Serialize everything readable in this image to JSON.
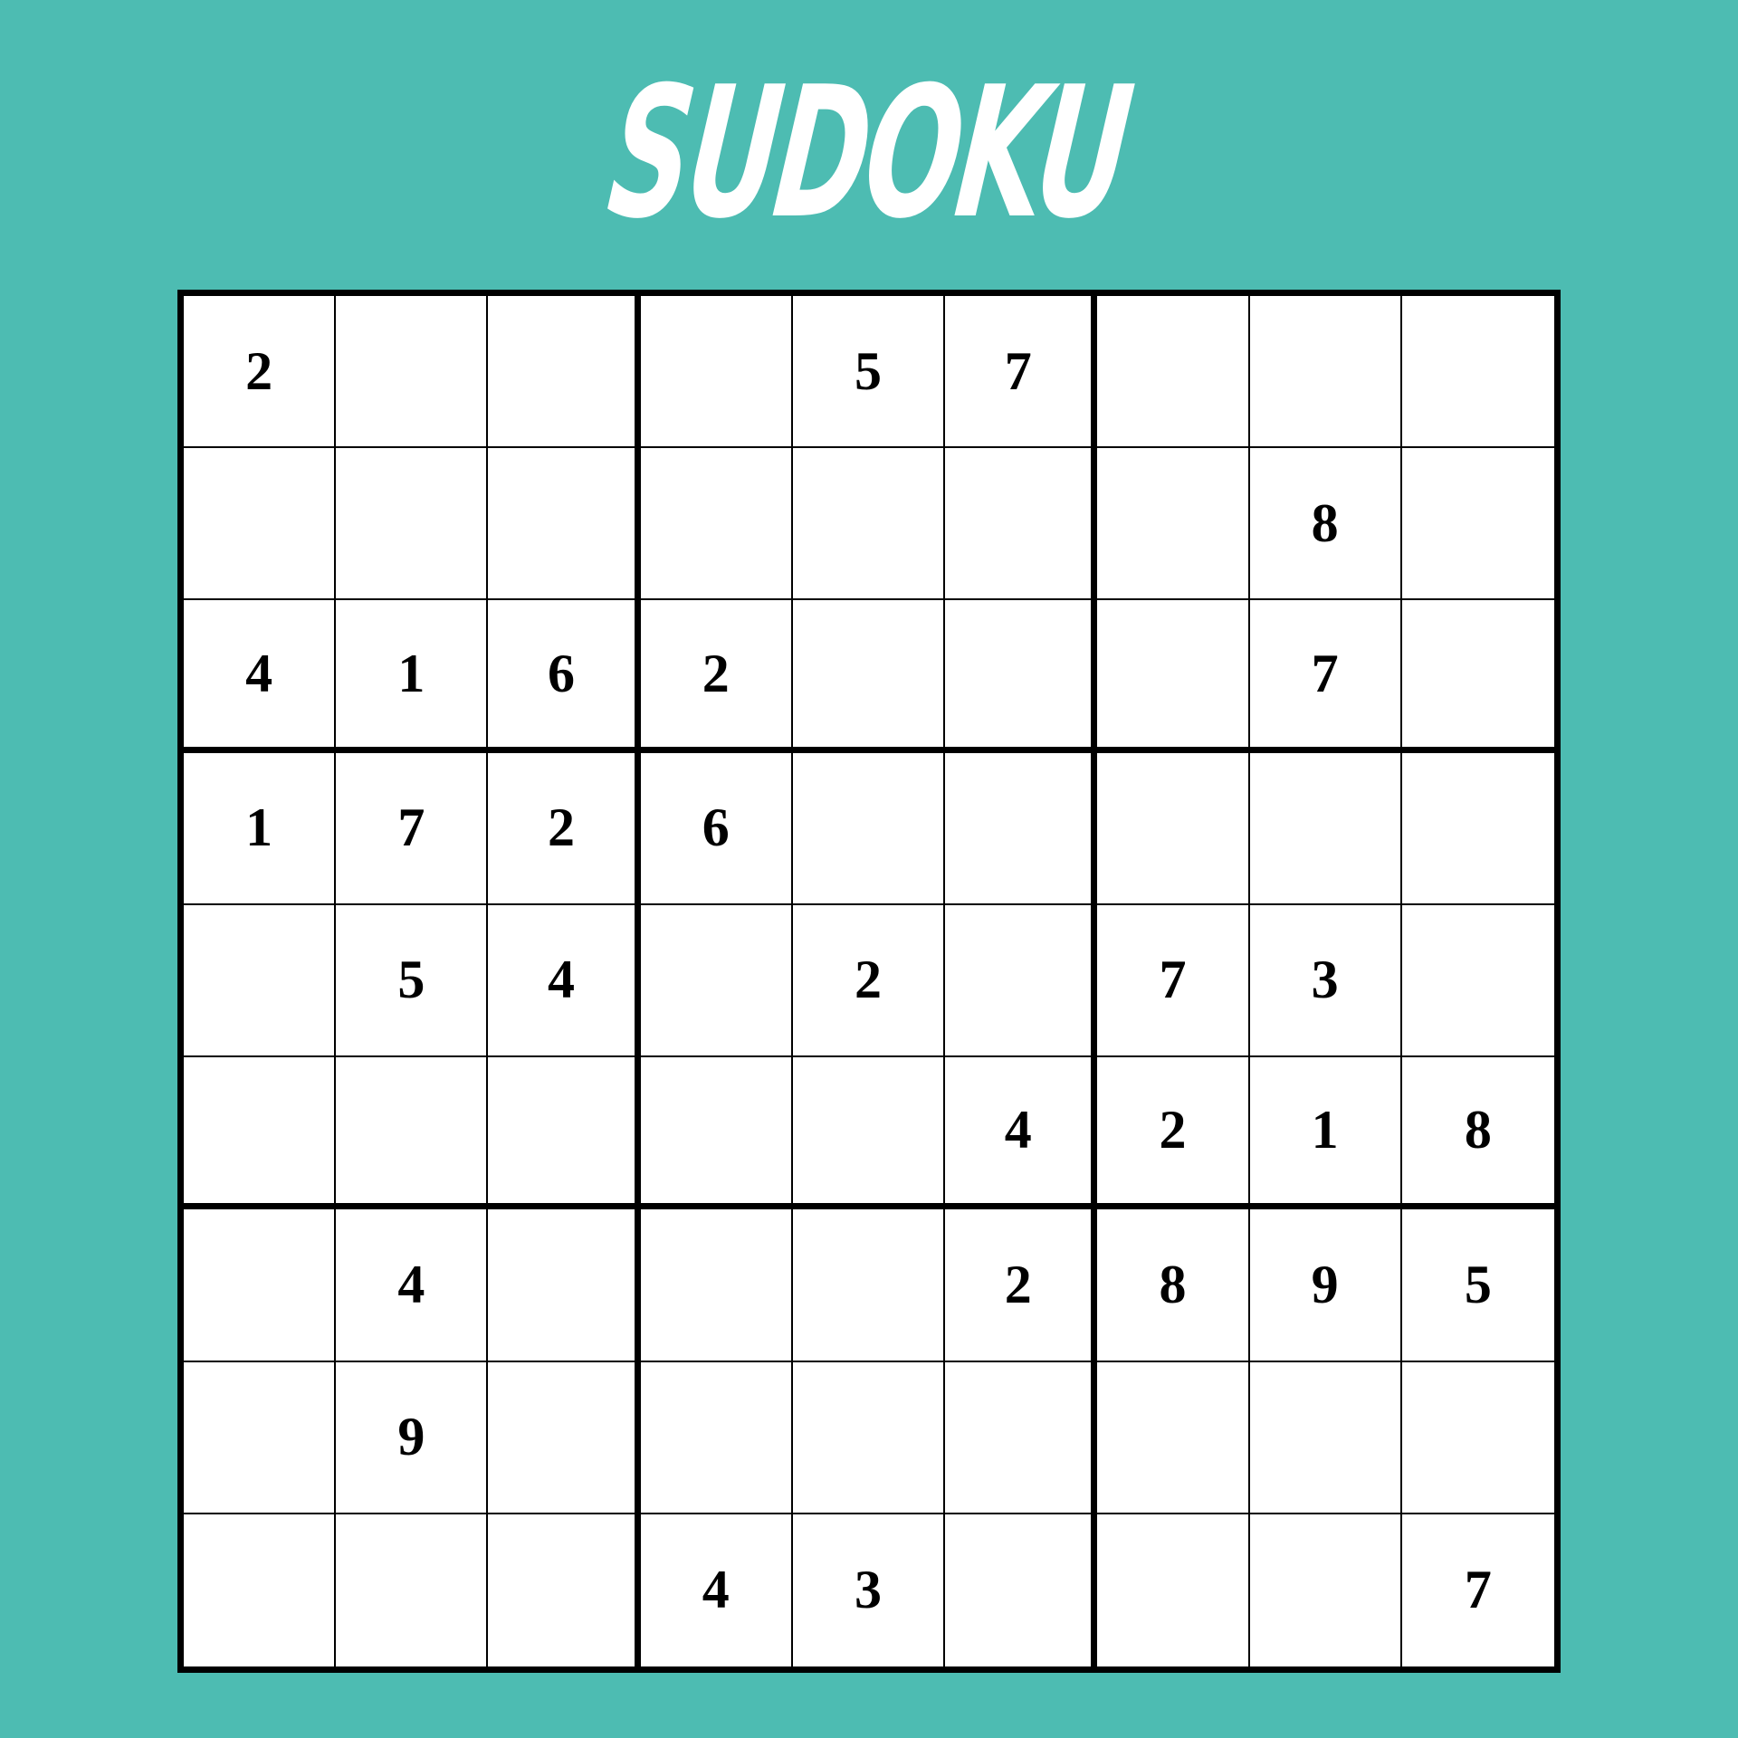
{
  "title": "SUDOKU",
  "colors": {
    "background": "#4dbcb2",
    "board": "#ffffff",
    "lines": "#000000",
    "digits": "#000000",
    "title": "#ffffff"
  },
  "board": {
    "rows": [
      [
        "2",
        "",
        "",
        "",
        "5",
        "7",
        "",
        "",
        ""
      ],
      [
        "",
        "",
        "",
        "",
        "",
        "",
        "",
        "8",
        ""
      ],
      [
        "4",
        "1",
        "6",
        "2",
        "",
        "",
        "",
        "7",
        ""
      ],
      [
        "1",
        "7",
        "2",
        "6",
        "",
        "",
        "",
        "",
        ""
      ],
      [
        "",
        "5",
        "4",
        "",
        "2",
        "",
        "7",
        "3",
        ""
      ],
      [
        "",
        "",
        "",
        "",
        "",
        "4",
        "2",
        "1",
        "8"
      ],
      [
        "",
        "4",
        "",
        "",
        "",
        "2",
        "8",
        "9",
        "5"
      ],
      [
        "",
        "9",
        "",
        "",
        "",
        "",
        "",
        "",
        ""
      ],
      [
        "",
        "",
        "",
        "4",
        "3",
        "",
        "",
        "",
        "7"
      ]
    ]
  }
}
